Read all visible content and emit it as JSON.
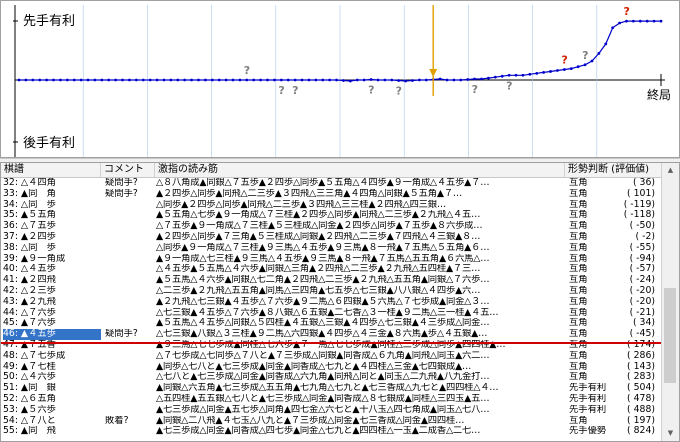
{
  "graph": {
    "label_sente": "先手有利",
    "label_gote": "後手有利",
    "label_end": "終局",
    "colors": {
      "line": "#0000cc",
      "marker": "#e0a000",
      "question": "#808080",
      "bad": "#d02000",
      "axis": "#000000",
      "grid": "#a8c8e8"
    },
    "points": [
      0,
      0,
      0,
      0,
      0,
      0,
      0,
      0,
      0,
      0,
      0,
      0,
      0,
      0,
      0,
      0,
      0,
      0,
      0,
      0,
      0,
      0,
      0,
      0,
      0,
      0,
      0,
      0,
      0,
      0,
      0,
      0,
      0,
      0,
      0,
      0,
      0,
      0,
      0,
      0,
      0,
      0,
      0,
      0,
      0,
      0,
      0,
      -0.5,
      -1,
      0,
      0,
      0.5,
      0,
      0,
      0,
      -0.5,
      -1,
      -0.5,
      0,
      0,
      0.5,
      1,
      0,
      0,
      0,
      0.5,
      1,
      1,
      2,
      3,
      4,
      5,
      5,
      5,
      6,
      7,
      8,
      9,
      10,
      11,
      12,
      14,
      16,
      20,
      28,
      38,
      55,
      60,
      62,
      62,
      62,
      62,
      62,
      62
    ],
    "marks": [
      {
        "i": 33,
        "text": "?",
        "kind": "question",
        "dy": -1
      },
      {
        "i": 38,
        "text": "?",
        "kind": "question",
        "dy": 1
      },
      {
        "i": 40,
        "text": "?",
        "kind": "question",
        "dy": 1
      },
      {
        "i": 51,
        "text": "?",
        "kind": "question",
        "dy": 1
      },
      {
        "i": 55,
        "text": "?",
        "kind": "question",
        "dy": 1
      },
      {
        "i": 66,
        "text": "?",
        "kind": "question",
        "dy": 1
      },
      {
        "i": 71,
        "text": "?",
        "kind": "question",
        "dy": 1
      },
      {
        "i": 79,
        "text": "?",
        "kind": "bad",
        "dy": -1
      },
      {
        "i": 82,
        "text": "?",
        "kind": "question",
        "dy": -1
      },
      {
        "i": 88,
        "text": "?",
        "kind": "bad",
        "dy": -1
      }
    ],
    "current_index": 60
  },
  "table": {
    "headers": {
      "move": "棋譜",
      "comment": "コメント",
      "line": "激指の読み筋",
      "judge": "形勢判断 (評価値)"
    },
    "rows": [
      {
        "move": "32: △４四角",
        "comment": "疑問手?",
        "line": "△８八角成▲同銀△７五歩▲２四歩△同歩▲５五角△４四歩▲９一角成△４五歩▲７…",
        "judge": "互角",
        "val": "(    36)"
      },
      {
        "move": "33: ▲同　角",
        "comment": "疑問手?",
        "line": "▲２四歩△同歩▲同飛△二三歩▲３四飛△三三角▲４四角△同銀▲５五角▲７…",
        "judge": "互角",
        "val": "(   101)"
      },
      {
        "move": "34: △同　歩",
        "comment": "",
        "line": "△同歩▲２四歩△同歩▲同飛△二三歩▲３四飛△三三桂▲２四飛△四三銀…",
        "judge": "互角",
        "val": "(  -119)"
      },
      {
        "move": "35: ▲５五角",
        "comment": "",
        "line": "▲５五角△七歩▲９一角成△７三桂▲２四歩△同歩▲同飛△二三歩▲２九飛△４五…",
        "judge": "互角",
        "val": "(  -118)"
      },
      {
        "move": "36: △７五歩",
        "comment": "",
        "line": "△７五歩▲９一角成△７三桂▲５三桂成△同金▲２四歩△同歩▲７五歩▲８六歩成…",
        "judge": "互角",
        "val": "(   -50)"
      },
      {
        "move": "37: ▲２四歩",
        "comment": "",
        "line": "▲２四歩△同歩▲７三角▲５三桂成△同銀▲２四飛△二三歩▲７四飛△４三銀▲８…",
        "judge": "互角",
        "val": "(    -2)"
      },
      {
        "move": "38: △同　歩",
        "comment": "",
        "line": "△同歩▲９一角成△７三桂▲９三馬△４五歩▲９三馬▲８一飛▲７五馬△５五角▲６…",
        "judge": "互角",
        "val": "(   -55)"
      },
      {
        "move": "39: ▲９一角成",
        "comment": "",
        "line": "▲９一角成△七三桂▲９三馬△４五歩▲９三馬▲８一飛▲７五馬△五五角▲６六馬△…",
        "judge": "互角",
        "val": "(   -94)"
      },
      {
        "move": "40: △４五歩",
        "comment": "",
        "line": "△４五歩▲５五馬△４六歩▲同銀△三角▲２四飛△二三歩▲２九飛△五四桂▲７三…",
        "judge": "互角",
        "val": "(   -57)"
      },
      {
        "move": "41: ▲２四飛",
        "comment": "",
        "line": "▲５五馬△４六歩▲同銀△七二角▲２四飛△二三歩▲２九飛△五五角▲同銀△７六歩…",
        "judge": "互角",
        "val": "(   -24)"
      },
      {
        "move": "42: △２三歩",
        "comment": "",
        "line": "△二三歩▲２九飛△五五角▲同馬△三四角▲七五歩△七三銀▲八八銀△４四歩▲六…",
        "judge": "互角",
        "val": "(   -20)"
      },
      {
        "move": "43: ▲２九飛",
        "comment": "",
        "line": "▲２九飛△七三銀▲４五歩△７六歩▲９二馬△６四銀▲５六馬△７七歩成▲同金△３…",
        "judge": "互角",
        "val": "(   -20)"
      },
      {
        "move": "44: △７六歩",
        "comment": "",
        "line": "△七三銀▲４五歩△７六歩▲８八銀△６五銀▲二七香△３一桂▲９二馬△三一桂▲４五…",
        "judge": "互角",
        "val": "(   -21)"
      },
      {
        "move": "45: ▲７六歩",
        "comment": "",
        "line": "▲５五馬△４五歩△同銀△５四桂▲４五銀△三銀▲４四歩△七三銀▲４三歩成△同金…",
        "judge": "互角",
        "val": "(    34)"
      },
      {
        "move": "46: ▲４五歩",
        "comment": "疑問手?",
        "line": "△七三銀▲八銀△３三桂▲９二馬△六四銀▲４四歩△４三金▲８六馬▲歩△４五銀▲…",
        "judge": "互角",
        "val": "(   -45)",
        "selected": true
      },
      {
        "move": "47: ▲７五香",
        "comment": "",
        "line": "▲９三馬△七七歩成▲同桂△七六歩▲７一馬△七七歩成▲同桂△三歩成△同歩▲四四桂▲…",
        "judge": "互角",
        "val": "(   174)"
      },
      {
        "move": "48: △７七歩成",
        "comment": "",
        "line": "△７七歩成△七同歩△７八と▲７三歩成△同銀▲同香成△６九角▲同飛△同玉▲六二…",
        "judge": "互角",
        "val": "(   286)"
      },
      {
        "move": "49: ▲７七桂",
        "comment": "",
        "line": "▲同歩△七八と▲七三歩成▲同金▲同香成△七九と▲４四桂△三金▲七四銀成▲…",
        "judge": "互角",
        "val": "(   143)"
      },
      {
        "move": "50: △４六歩",
        "comment": "",
        "line": "△七八と▲七三歩成△同金▲同香成△六九角▲同飛△同と▲同玉△二九飛▲八九金打…",
        "judge": "互角",
        "val": "(   283)"
      },
      {
        "move": "51: ▲同　銀",
        "comment": "",
        "line": "▲同銀△六五角▲七三歩成△五五角▲七九角△七九と▲七三香成△九七と▲四四桂△４…",
        "judge": "先手有利",
        "val": "(   504)"
      },
      {
        "move": "52: △６五角",
        "comment": "",
        "line": "△五四桂▲五五銀△七八と▲七三歩成△同金▲同香成△８七銀成▲同桂△三四玉▲五…",
        "judge": "先手有利",
        "val": "(   478)"
      },
      {
        "move": "53: ▲５六歩",
        "comment": "",
        "line": "▲七三歩成△同金▲五七歩△同角▲四七金△六七と▲十八玉△四七角成▲同玉△七八…",
        "judge": "先手有利",
        "val": "(   488)"
      },
      {
        "move": "54: △７八と",
        "comment": "敗着?",
        "line": "▲同銀△二八飛▲４七玉△八九と▲７三歩成△同金▲七三香成△同金▲四四桂…",
        "judge": "互角",
        "val": "(   197)"
      },
      {
        "move": "55: ▲同　飛",
        "comment": "",
        "line": "▲七三歩成△同金▲同香成△四七歩▲同金△七九と▲四四桂△一玉▲二成香△二七…",
        "judge": "先手優勢",
        "val": "(   824)"
      }
    ]
  }
}
